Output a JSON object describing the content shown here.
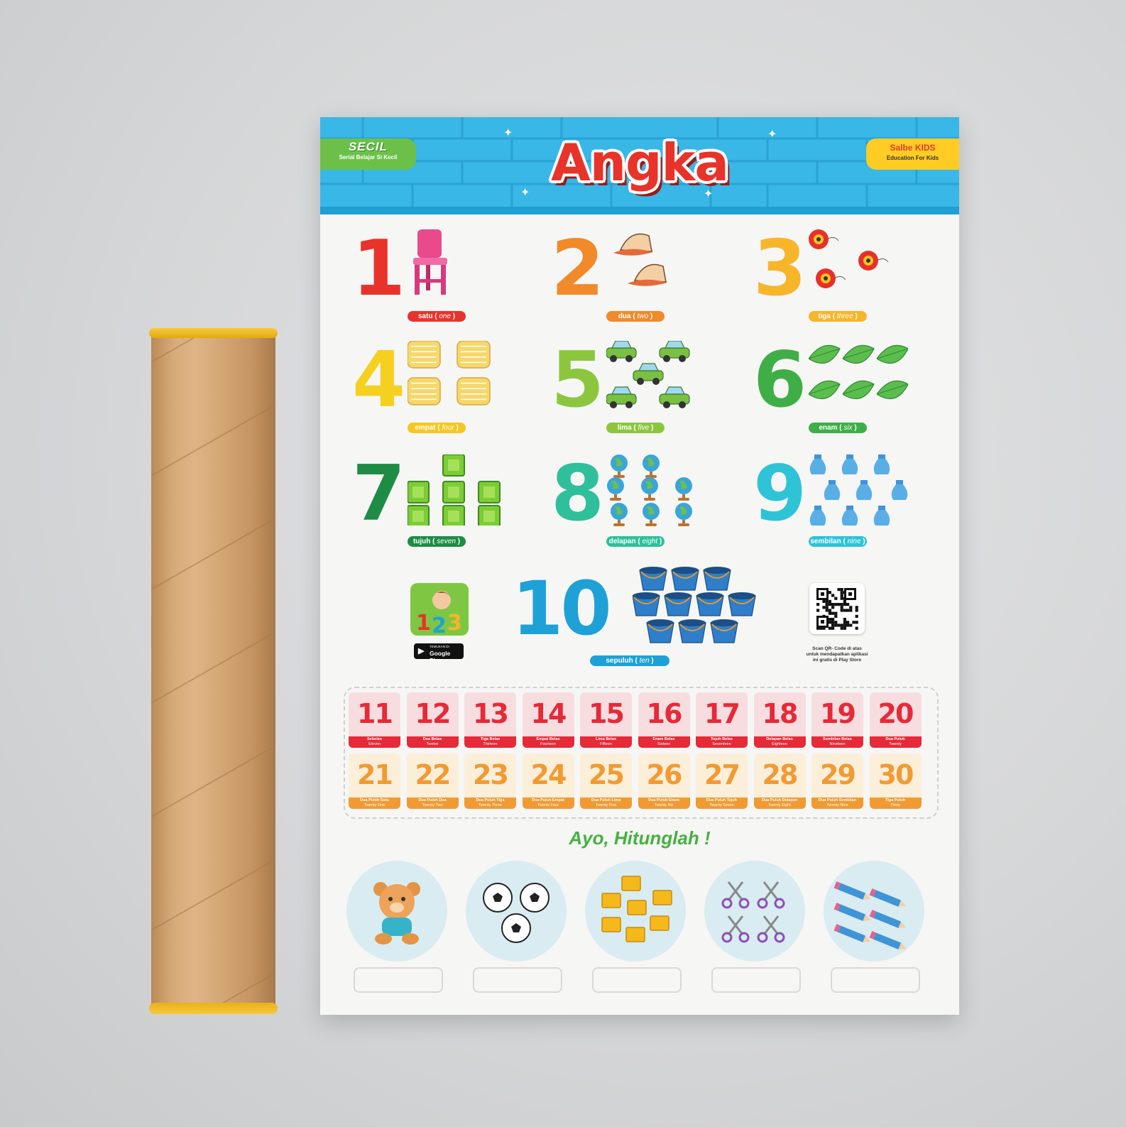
{
  "poster": {
    "title": "Angka",
    "brand_left": {
      "name": "SECIL",
      "tagline": "Serial Belajar Si Kecil"
    },
    "brand_right": {
      "name": "Salbe KIDS",
      "tagline": "Education For Kids"
    },
    "numbers": [
      {
        "digit": "1",
        "word": "satu",
        "en": "one",
        "color": "#e8332b",
        "label_color": "#e8332b",
        "object": "chair"
      },
      {
        "digit": "2",
        "word": "dua",
        "en": "two",
        "color": "#f08a2b",
        "label_color": "#f08a2b",
        "object": "cap"
      },
      {
        "digit": "3",
        "word": "tiga",
        "en": "three",
        "color": "#f7b52a",
        "label_color": "#f7b52a",
        "object": "yoyo"
      },
      {
        "digit": "4",
        "word": "empat",
        "en": "four",
        "color": "#f5d01f",
        "label_color": "#f5c71f",
        "object": "pillow"
      },
      {
        "digit": "5",
        "word": "lima",
        "en": "five",
        "color": "#8cc63e",
        "label_color": "#8cc63e",
        "object": "car"
      },
      {
        "digit": "6",
        "word": "enam",
        "en": "six",
        "color": "#3fae47",
        "label_color": "#3fae47",
        "object": "leaf"
      },
      {
        "digit": "7",
        "word": "tujuh",
        "en": "seven",
        "color": "#1f8c45",
        "label_color": "#1f8c45",
        "object": "gem"
      },
      {
        "digit": "8",
        "word": "delapan",
        "en": "eight",
        "color": "#2fbf9a",
        "label_color": "#2fbf9a",
        "object": "globe"
      },
      {
        "digit": "9",
        "word": "sembilan",
        "en": "nine",
        "color": "#2ec3d6",
        "label_color": "#2ec3d6",
        "object": "vase"
      },
      {
        "digit": "10",
        "word": "sepuluh",
        "en": "ten",
        "color": "#1ea1d6",
        "label_color": "#1ea1d6",
        "object": "bucket"
      }
    ],
    "app": {
      "store_badge_small": "TEMUKAN DI",
      "store_badge": "Google Play"
    },
    "qr_caption": [
      "Scan QR- Code di atas",
      "untuk mendapatkan aplikasi",
      "ini gratis di Play Store"
    ],
    "teens": [
      {
        "n": "11",
        "id": "Sebelas",
        "en": "Eleven"
      },
      {
        "n": "12",
        "id": "Dua Belas",
        "en": "Twelve"
      },
      {
        "n": "13",
        "id": "Tiga Belas",
        "en": "Thirteen"
      },
      {
        "n": "14",
        "id": "Empat Belas",
        "en": "Fourteen"
      },
      {
        "n": "15",
        "id": "Lima Belas",
        "en": "Fifteen"
      },
      {
        "n": "16",
        "id": "Enam Belas",
        "en": "Sixteen"
      },
      {
        "n": "17",
        "id": "Tujuh Belas",
        "en": "Seventeen"
      },
      {
        "n": "18",
        "id": "Delapan Belas",
        "en": "Eighteen"
      },
      {
        "n": "19",
        "id": "Sembilan Belas",
        "en": "Nineteen"
      },
      {
        "n": "20",
        "id": "Dua Puluh",
        "en": "Twenty"
      }
    ],
    "twenties": [
      {
        "n": "21",
        "id": "Dua Puluh Satu",
        "en": "Twenty One"
      },
      {
        "n": "22",
        "id": "Dua Puluh Dua",
        "en": "Twenty Two"
      },
      {
        "n": "23",
        "id": "Dua Puluh Tiga",
        "en": "Twenty Three"
      },
      {
        "n": "24",
        "id": "Dua Puluh Empat",
        "en": "Twenty Four"
      },
      {
        "n": "25",
        "id": "Dua Puluh Lima",
        "en": "Twenty Five"
      },
      {
        "n": "26",
        "id": "Dua Puluh Enam",
        "en": "Twenty Six"
      },
      {
        "n": "27",
        "id": "Dua Puluh Tujuh",
        "en": "Twenty Seven"
      },
      {
        "n": "28",
        "id": "Dua Puluh Delapan",
        "en": "Twenty Eight"
      },
      {
        "n": "29",
        "id": "Dua Puluh Sembilan",
        "en": "Twenty Nine"
      },
      {
        "n": "30",
        "id": "Tiga Puluh",
        "en": "Thirty"
      }
    ],
    "exercise_title": "Ayo, Hitunglah !",
    "exercise_items": [
      "teddy-bear",
      "soccer-ball",
      "book",
      "scissors",
      "pencil"
    ],
    "colors": {
      "header": "#39b7e6",
      "teen_red": "#e52a38",
      "twenty_orange": "#f29a32",
      "ayo_green": "#45b140"
    }
  }
}
